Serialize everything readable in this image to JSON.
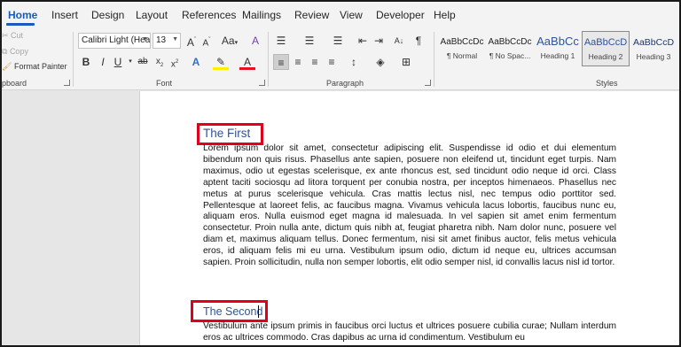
{
  "ribbon_tabs": [
    "Home",
    "Insert",
    "Design",
    "Layout",
    "References",
    "Mailings",
    "Review",
    "View",
    "Developer",
    "Help"
  ],
  "clipboard": {
    "cut": "Cut",
    "copy": "Copy",
    "format_painter": "Format Painter",
    "group_label": "pboard"
  },
  "font": {
    "name": "Calibri Light (Hea",
    "size": "13",
    "group_label": "Font"
  },
  "paragraph": {
    "group_label": "Paragraph"
  },
  "styles": {
    "group_label": "Styles",
    "items": [
      {
        "sample": "AaBbCcDc",
        "name": "¶ Normal"
      },
      {
        "sample": "AaBbCcDc",
        "name": "¶ No Spac..."
      },
      {
        "sample": "AaBbCc",
        "name": "Heading 1"
      },
      {
        "sample": "AaBbCcD",
        "name": "Heading 2"
      },
      {
        "sample": "AaBbCcD",
        "name": "Heading 3"
      }
    ]
  },
  "document": {
    "heading1": "The First",
    "para1": "Lorem ipsum dolor sit amet, consectetur adipiscing elit. Suspendisse id odio et dui elementum bibendum non quis risus. Phasellus ante sapien, posuere non eleifend ut, tincidunt eget turpis. Nam maximus, odio ut egestas scelerisque, ex ante rhoncus est, sed tincidunt odio neque id orci. Class aptent taciti sociosqu ad litora torquent per conubia nostra, per inceptos himenaeos. Phasellus nec metus at purus scelerisque vehicula. Cras mattis lectus nisl, nec tempus odio porttitor sed. Pellentesque at laoreet felis, ac faucibus magna. Vivamus vehicula lacus lobortis, faucibus nunc eu, aliquam eros. Nulla euismod eget magna id malesuada. In vel sapien sit amet enim fermentum consectetur. Proin nulla ante, dictum quis nibh at, feugiat pharetra nibh. Nam dolor nunc, posuere vel diam et, maximus aliquam tellus. Donec fermentum, nisi sit amet finibus auctor, felis metus vehicula eros, id aliquam felis mi eu urna. Vestibulum ipsum odio, dictum id neque eu, ultrices accumsan sapien. Proin sollicitudin, nulla non semper lobortis, elit odio semper nisl, id convallis lacus nisl id tortor.",
    "heading2": "The Second",
    "para2": "Vestibulum ante ipsum primis in faucibus orci luctus et ultrices posuere cubilia curae; Nullam interdum eros ac ultrices commodo. Cras dapibus ac urna id condimentum. Vestibulum eu"
  },
  "colors": {
    "accent": "#185abd",
    "heading": "#2f5496",
    "highlight": "#e0001b"
  }
}
